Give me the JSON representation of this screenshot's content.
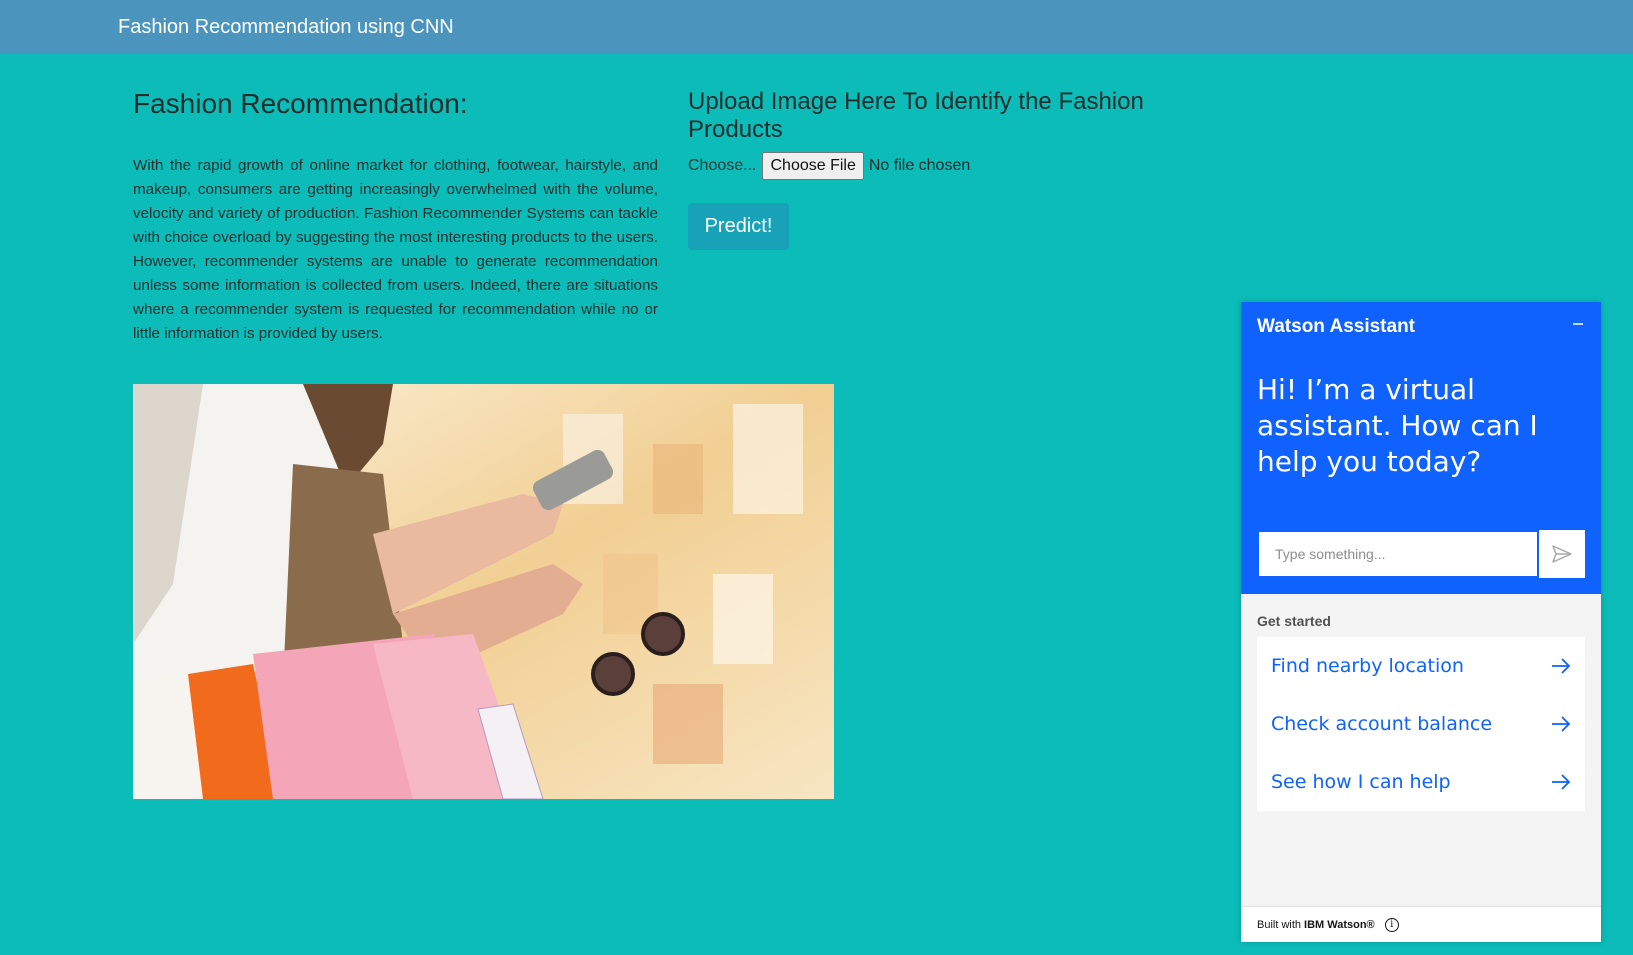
{
  "navbar": {
    "brand": "Fashion Recommendation using CNN"
  },
  "left": {
    "title": "Fashion Recommendation:",
    "description": "With the rapid growth of online market for clothing, footwear, hairstyle, and makeup, consumers are getting increasingly overwhelmed with the volume, velocity and variety of production. Fashion Recommender Systems can tackle with choice overload by suggesting the most interesting products to the users. However, recommender systems are unable to generate recommendation unless some information is collected from users. Indeed, there are situations where a recommender system is requested for recommendation while no or little information is provided by users.",
    "hero_image": "woman-shopping-with-phone-and-bags"
  },
  "upload": {
    "title": "Upload Image Here To Identify the Fashion Products",
    "choose_label": "Choose...",
    "file_button": "Choose File",
    "file_status": "No file chosen",
    "predict_button": "Predict!"
  },
  "watson": {
    "title": "Watson Assistant",
    "minimize_icon": "minimize-icon",
    "greeting": "Hi! I’m a virtual assistant. How can I help you today?",
    "input_placeholder": "Type something...",
    "send_icon": "send-icon",
    "get_started": "Get started",
    "suggestions": [
      {
        "label": "Find nearby location"
      },
      {
        "label": "Check account balance"
      },
      {
        "label": "See how I can help"
      }
    ],
    "footer_prefix": "Built with",
    "footer_brand": "IBM Watson®",
    "info_icon": "info-icon"
  },
  "colors": {
    "page_bg": "#0bbcb8",
    "navbar_bg": "#4a94bd",
    "predict_bg": "#17a2b8",
    "watson_blue": "#0f62fe"
  }
}
